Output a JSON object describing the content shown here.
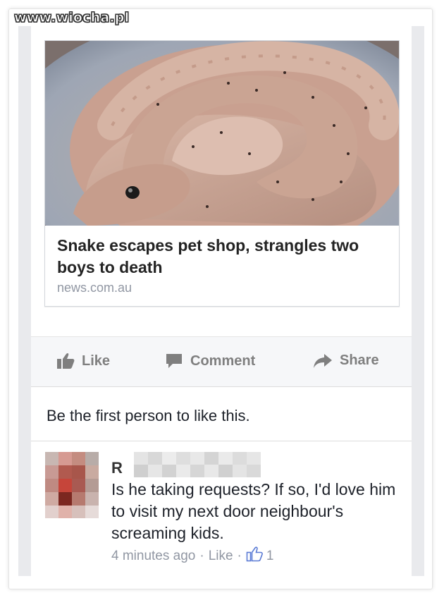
{
  "watermark": "www.wiocha.pl",
  "link": {
    "title": "Snake escapes pet shop, strangles two boys to death",
    "source": "news.com.au",
    "image_subject": "snake coiled in a bowl"
  },
  "actions": {
    "like": "Like",
    "comment": "Comment",
    "share": "Share"
  },
  "likes_text": "Be the first person to like this.",
  "comment": {
    "author_visible": "R",
    "text": "Is he taking requests? If so, I'd love him to visit my next door neighbour's screaming kids.",
    "time": "4 minutes ago",
    "sep1": "·",
    "like_label": "Like",
    "sep2": "·",
    "like_count": "1"
  },
  "colors": {
    "action_gray": "#7f7f7f",
    "meta_gray": "#9197a3",
    "like_blue": "#5b7bd5"
  }
}
